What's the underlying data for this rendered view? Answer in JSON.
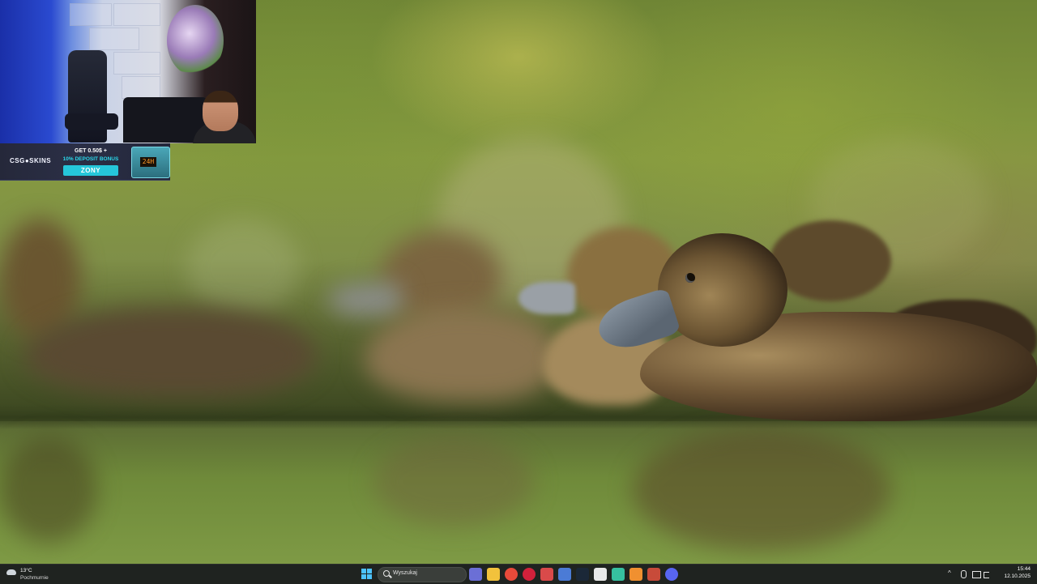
{
  "wallpaper": {
    "subject": "ducklings-on-water"
  },
  "stream_overlay": {
    "banner": {
      "brand": "CSG●SKINS",
      "line1": "GET 0.50$ +",
      "line2": "10% DEPOSIT BONUS",
      "code": "ZONY",
      "box_display": "24H"
    }
  },
  "taskbar": {
    "weather": {
      "temperature": "13°C",
      "condition": "Pochmurnie",
      "icon": "cloud-icon"
    },
    "search": {
      "placeholder": "Wyszukaj",
      "icon": "search-icon"
    },
    "pinned_apps": [
      {
        "name": "teams-icon",
        "color": "#6b6fd6"
      },
      {
        "name": "file-explorer-icon",
        "color": "#f2c23c"
      },
      {
        "name": "chrome-icon",
        "color": "#e84a3a"
      },
      {
        "name": "opera-icon",
        "color": "#d2213b"
      },
      {
        "name": "app-icon-5",
        "color": "#d94a4a"
      },
      {
        "name": "app-icon-6",
        "color": "#4b7bd6"
      },
      {
        "name": "steam-icon",
        "color": "#1b2838"
      },
      {
        "name": "app-icon-8",
        "color": "#e8e8e8"
      },
      {
        "name": "app-icon-9",
        "color": "#36c0a0"
      },
      {
        "name": "app-icon-10",
        "color": "#f09030"
      },
      {
        "name": "app-icon-11",
        "color": "#c84b3a"
      },
      {
        "name": "discord-icon",
        "color": "#5865f2"
      }
    ],
    "tray": {
      "chevron": "^",
      "clock_time": "15:44",
      "clock_date": "12.10.2025"
    }
  },
  "colors": {
    "taskbar_bg": "#1f2320",
    "accent": "#4cc2ff",
    "banner_cyan": "#25c6da"
  }
}
